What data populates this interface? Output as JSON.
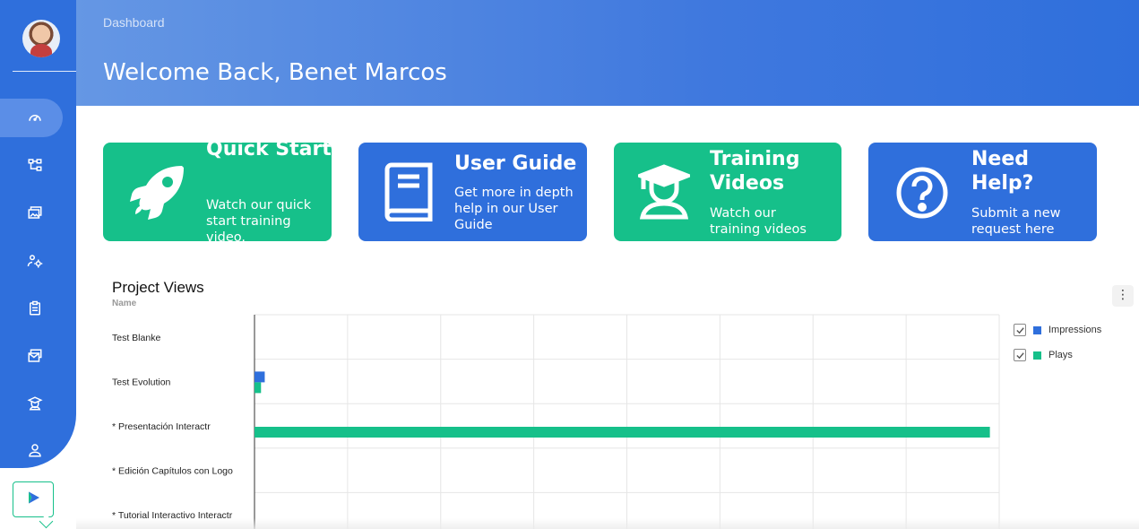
{
  "header": {
    "breadcrumb": "Dashboard",
    "welcome": "Welcome Back, Benet Marcos"
  },
  "sidebar": {
    "items": [
      {
        "name": "dashboard",
        "icon": "gauge-icon",
        "active": true
      },
      {
        "name": "projects",
        "icon": "tree-diagram-icon"
      },
      {
        "name": "media",
        "icon": "images-icon"
      },
      {
        "name": "users",
        "icon": "users-gear-icon"
      },
      {
        "name": "reports",
        "icon": "clipboard-icon"
      },
      {
        "name": "inbox",
        "icon": "mail-stack-icon"
      },
      {
        "name": "training",
        "icon": "graduate-icon"
      },
      {
        "name": "account",
        "icon": "user-icon"
      }
    ],
    "brand_icon": "brand-play-icon"
  },
  "cards": [
    {
      "title": "Quick Start",
      "text": "Watch our quick start training video.",
      "icon": "rocket-icon",
      "color": "#16c08a"
    },
    {
      "title": "User Guide",
      "text": "Get more in depth help in our User Guide",
      "icon": "book-icon",
      "color": "#2f6fdc"
    },
    {
      "title": "Training Videos",
      "text": "Watch our training videos",
      "icon": "graduate-icon",
      "color": "#16c08a"
    },
    {
      "title": "Need Help?",
      "text": "Submit a new request here",
      "icon": "question-icon",
      "color": "#2f6fdc"
    }
  ],
  "chart_panel": {
    "title": "Project Views",
    "subtitle": "Name",
    "more_icon": "more-vertical-icon"
  },
  "chart_data": {
    "type": "bar",
    "orientation": "horizontal",
    "categories": [
      "Test Blanke",
      "Test Evolution",
      "* Presentación Interactr",
      "* Edición Capítulos con Logo",
      "* Tutorial Interactivo Interactr"
    ],
    "series": [
      {
        "name": "Impressions",
        "color": "#2f6fdc",
        "values": [
          0,
          11,
          0,
          0,
          0
        ]
      },
      {
        "name": "Plays",
        "color": "#16c08a",
        "values": [
          0,
          7,
          790,
          0,
          0
        ]
      }
    ],
    "xlim": [
      0,
      800
    ],
    "grid": true,
    "legend_position": "right"
  }
}
